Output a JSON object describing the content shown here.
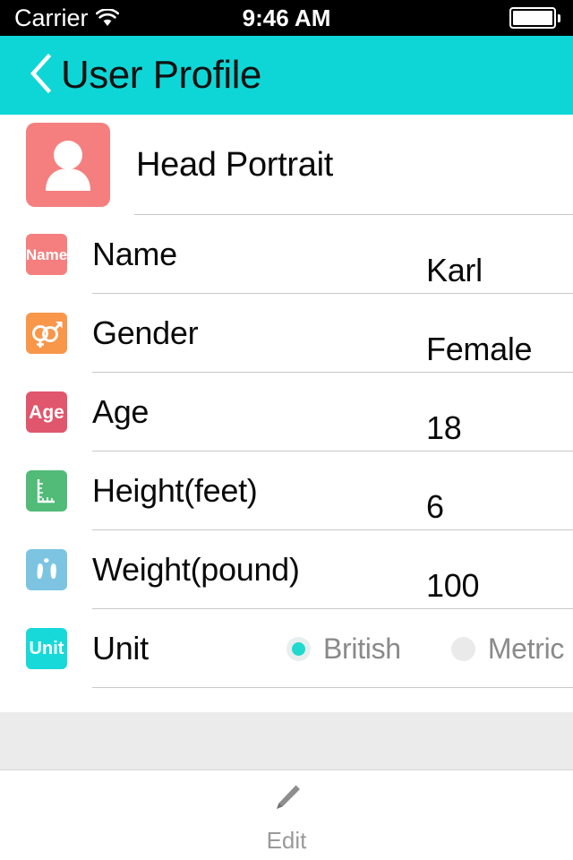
{
  "status_bar": {
    "carrier": "Carrier",
    "wifi_icon": "wifi-icon",
    "time": "9:46 AM",
    "battery_icon": "battery-full-icon"
  },
  "nav_bar": {
    "back_icon": "chevron-left-icon",
    "title": "User Profile",
    "background_color": "#0fd6d6"
  },
  "profile": {
    "portrait_row": {
      "icon": "person-avatar-icon",
      "icon_color": "#f57f7f",
      "label": "Head Portrait"
    },
    "fields": [
      {
        "key": "name",
        "icon": "name-badge-icon",
        "icon_text": "Name",
        "icon_color": "#f57f7f",
        "label": "Name",
        "value": "Karl"
      },
      {
        "key": "gender",
        "icon": "gender-symbols-icon",
        "icon_text": "",
        "icon_color": "#f8964a",
        "label": "Gender",
        "value": "Female"
      },
      {
        "key": "age",
        "icon": "age-badge-icon",
        "icon_text": "Age",
        "icon_color": "#e0566c",
        "label": "Age",
        "value": "18"
      },
      {
        "key": "height",
        "icon": "ruler-icon",
        "icon_text": "",
        "icon_color": "#51bb77",
        "label": "Height(feet)",
        "value": "6"
      },
      {
        "key": "weight",
        "icon": "footprints-scale-icon",
        "icon_text": "",
        "icon_color": "#7cc4e2",
        "label": "Weight(pound)",
        "value": "100"
      }
    ],
    "unit_row": {
      "icon": "unit-badge-icon",
      "icon_text": "Unit",
      "icon_color": "#17d9d9",
      "label": "Unit",
      "options": [
        {
          "label": "British",
          "selected": true
        },
        {
          "label": "Metric",
          "selected": false
        }
      ],
      "selected_color": "#1fd9cf"
    }
  },
  "tab_bar": {
    "items": [
      {
        "icon": "pencil-edit-icon",
        "label": "Edit"
      }
    ]
  }
}
